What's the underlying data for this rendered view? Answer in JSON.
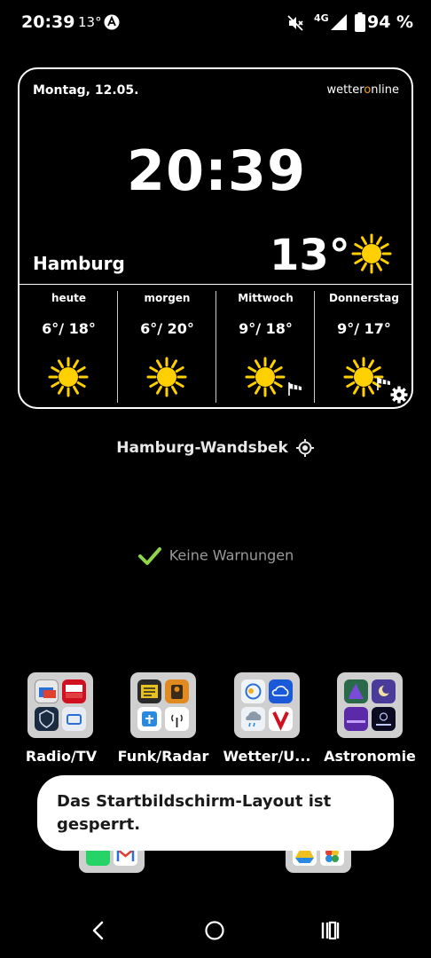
{
  "status_bar": {
    "time": "20:39",
    "temperature": "13°",
    "network": "4G",
    "battery": "94 %",
    "icons": [
      "app-notification-icon",
      "mute-icon",
      "signal-icon",
      "battery-icon"
    ]
  },
  "widget": {
    "date": "Montag, 12.05.",
    "brand_prefix": "wetter",
    "brand_o": "o",
    "brand_suffix": "nline",
    "clock": "20:39",
    "city": "Hamburg",
    "current_temp": "13°",
    "current_icon": "sun-icon",
    "forecast": [
      {
        "day": "heute",
        "temps": "6°/ 18°",
        "icon": "sun-icon"
      },
      {
        "day": "morgen",
        "temps": "6°/ 20°",
        "icon": "sun-icon"
      },
      {
        "day": "Mittwoch",
        "temps": "9°/ 18°",
        "icon": "sun-icon",
        "extra_icon": "windsock-icon"
      },
      {
        "day": "Donnerstag",
        "temps": "9°/ 17°",
        "icon": "sun-icon",
        "extra_icon": "windsock-icon"
      }
    ]
  },
  "location": {
    "name": "Hamburg-Wandsbek",
    "icon": "locate-icon"
  },
  "warnings": {
    "text": "Keine Warnungen",
    "icon": "check-icon"
  },
  "folders": [
    {
      "label": "Radio/TV"
    },
    {
      "label": "Funk/Radar"
    },
    {
      "label": "Wetter/U..."
    },
    {
      "label": "Astronomie"
    }
  ],
  "toast": {
    "text": "Das Startbildschirm-Layout ist gesperrt."
  },
  "nav": {
    "icons": [
      "back-icon",
      "home-icon",
      "recents-icon"
    ]
  },
  "colors": {
    "sun": "#ffd000",
    "brand_accent": "#f0a020",
    "check": "#8fd44a",
    "background": "#000000"
  }
}
